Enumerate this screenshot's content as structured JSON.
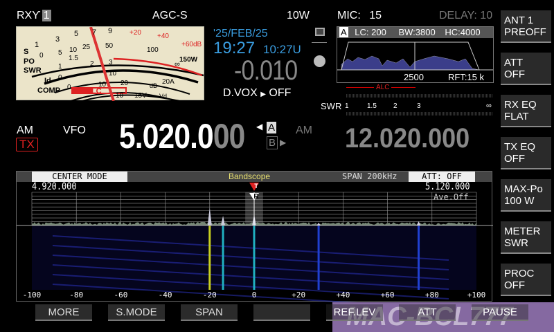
{
  "status": {
    "rx": "RX",
    "ant_num": "1",
    "agc": "AGC-S",
    "power": "10W",
    "mic_label": "MIC:",
    "mic_value": "15",
    "delay": "DELAY: 10"
  },
  "meter": {
    "s_label": "S",
    "po_label": "PO",
    "swr_label": "SWR",
    "id_label": "Id",
    "comp_label": "COMP",
    "alc_label": "ALC",
    "s_ticks": [
      "1",
      "3",
      "5",
      "7",
      "9",
      "+20",
      "+40",
      "+60dB"
    ],
    "po_ticks": [
      "0",
      "5",
      "10",
      "25",
      "50",
      "100",
      "150W"
    ],
    "swr_ticks": [
      "1",
      "1.5",
      "2",
      "3",
      "∞"
    ],
    "id_ticks": [
      "0",
      "10",
      "20A"
    ],
    "comp_ticks": [
      "0",
      "10",
      "20",
      "dB"
    ],
    "vd_ticks": [
      "10",
      "15V",
      "Vd"
    ]
  },
  "clock": {
    "date": "'25/FEB/25",
    "local": "19:27",
    "utc": "10:27U"
  },
  "rit": "-0.010",
  "dvox": {
    "label": "D.VOX",
    "value": "OFF"
  },
  "filter": {
    "vfo": "A",
    "lc": "LC: 200",
    "bw": "BW:3800",
    "hc": "HC:4000",
    "center": "2500",
    "rft": "RFT:15 k"
  },
  "tx_meter": {
    "alc": "ALC",
    "swr": "SWR",
    "swr_ticks": [
      "1",
      "1.5",
      "2",
      "3",
      "∞"
    ]
  },
  "main": {
    "mode": "AM",
    "tx": "TX",
    "vfo": "VFO",
    "freq_main": "5.020.0",
    "freq_dim": "00",
    "vfo_a": "A",
    "vfo_b": "B",
    "sub_mode": "AM",
    "sub_freq": "12.020.000"
  },
  "right_buttons": [
    [
      "ANT 1",
      "PREOFF"
    ],
    [
      "ATT",
      "OFF"
    ],
    [
      "RX EQ",
      "FLAT"
    ],
    [
      "TX EQ",
      "OFF"
    ],
    [
      "MAX-Po",
      "100 W"
    ],
    [
      "METER",
      "SWR"
    ],
    [
      "PROC",
      "OFF"
    ]
  ],
  "scope": {
    "mode": "CENTER MODE",
    "title": "Bandscope",
    "span": "SPAN 200kHz",
    "att": "ATT: OFF",
    "low": "4.920.000",
    "high": "5.120.000",
    "ave": "Ave.Off",
    "tx_marker": "T",
    "rx_marker": "R",
    "axis": [
      "-100",
      "-80",
      "-60",
      "-40",
      "-20",
      "0",
      "+20",
      "+40",
      "+60",
      "+80",
      "+100"
    ],
    "signals_khz": [
      -20,
      -14,
      0,
      29,
      74
    ]
  },
  "bottom_buttons": [
    "MORE",
    "S.MODE",
    "SPAN",
    "",
    "REF.LEV",
    "ATT",
    "PAUSE"
  ],
  "watermark": "MAC-BCL777",
  "colors": {
    "accent_blue": "#3a9de0",
    "tx_red": "#e02020",
    "meter_bg": "#ebe4c9"
  }
}
